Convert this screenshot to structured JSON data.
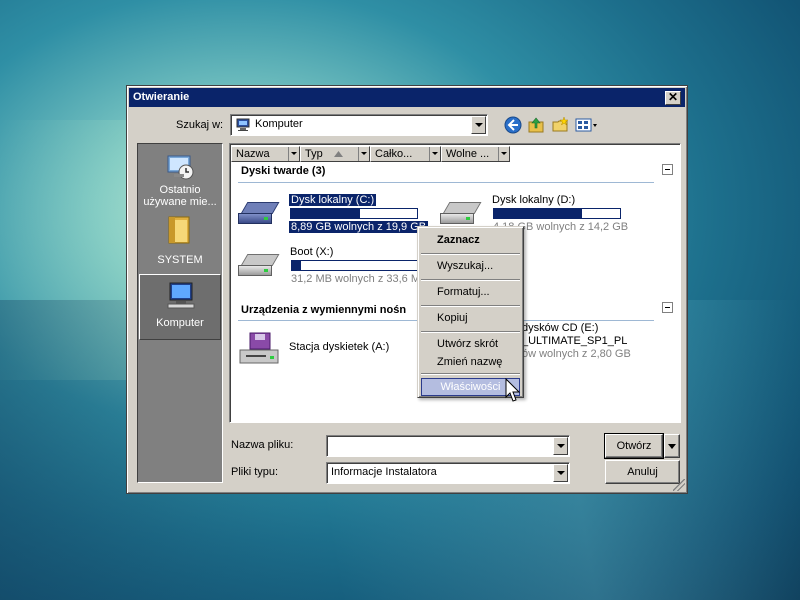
{
  "desktop": {
    "accent": "#1d6f8c"
  },
  "dialog": {
    "title": "Otwieranie",
    "close_glyph": "✕",
    "lookin": {
      "label": "Szukaj w:",
      "value": "Komputer",
      "icon": "computer-icon"
    },
    "toolbar": [
      {
        "name": "back-icon"
      },
      {
        "name": "up-folder-icon"
      },
      {
        "name": "new-folder-icon"
      },
      {
        "name": "view-menu-icon"
      }
    ],
    "places": [
      {
        "label": "Ostatnio używane mie...",
        "icon": "recent-places-icon"
      },
      {
        "label": "SYSTEM",
        "icon": "user-folder-icon"
      },
      {
        "label": "Komputer",
        "icon": "computer-icon",
        "active": true
      }
    ],
    "columns": [
      "Nazwa",
      "Typ",
      "Całko...",
      "Wolne ..."
    ],
    "groups": [
      {
        "title": "Dyski twarde (3)",
        "items": [
          {
            "name": "Dysk lokalny (C:)",
            "info": "8,89 GB wolnych z 19,9 GB",
            "used_fraction": 0.55,
            "selected": true
          },
          {
            "name": "Dysk lokalny (D:)",
            "info": "4,18 GB wolnych z 14,2 GB",
            "used_fraction": 0.7
          },
          {
            "name": "Boot (X:)",
            "info": "31,2 MB wolnych z 33,6 MB",
            "used_fraction": 0.07
          }
        ]
      },
      {
        "title": "Urządzenia z wymiennymi nośn",
        "items": [
          {
            "name": "Stacja dyskietek (A:)"
          },
          {
            "name": "dysków CD (E:)",
            "line2": "_ULTIMATE_SP1_PL",
            "info": "ów wolnych z 2,80 GB"
          }
        ]
      }
    ],
    "filename": {
      "label": "Nazwa pliku:",
      "value": ""
    },
    "filetype": {
      "label": "Pliki typu:",
      "value": "Informacje Instalatora"
    },
    "buttons": {
      "open": "Otwórz",
      "cancel": "Anuluj"
    }
  },
  "context_menu": {
    "items": [
      "Zaznacz",
      "Wyszukaj...",
      "Formatuj...",
      "Kopiuj",
      "Utwórz skrót",
      "Zmień nazwę",
      "Właściwości"
    ],
    "default_item": "Zaznacz",
    "hover_item": "Właściwości"
  }
}
